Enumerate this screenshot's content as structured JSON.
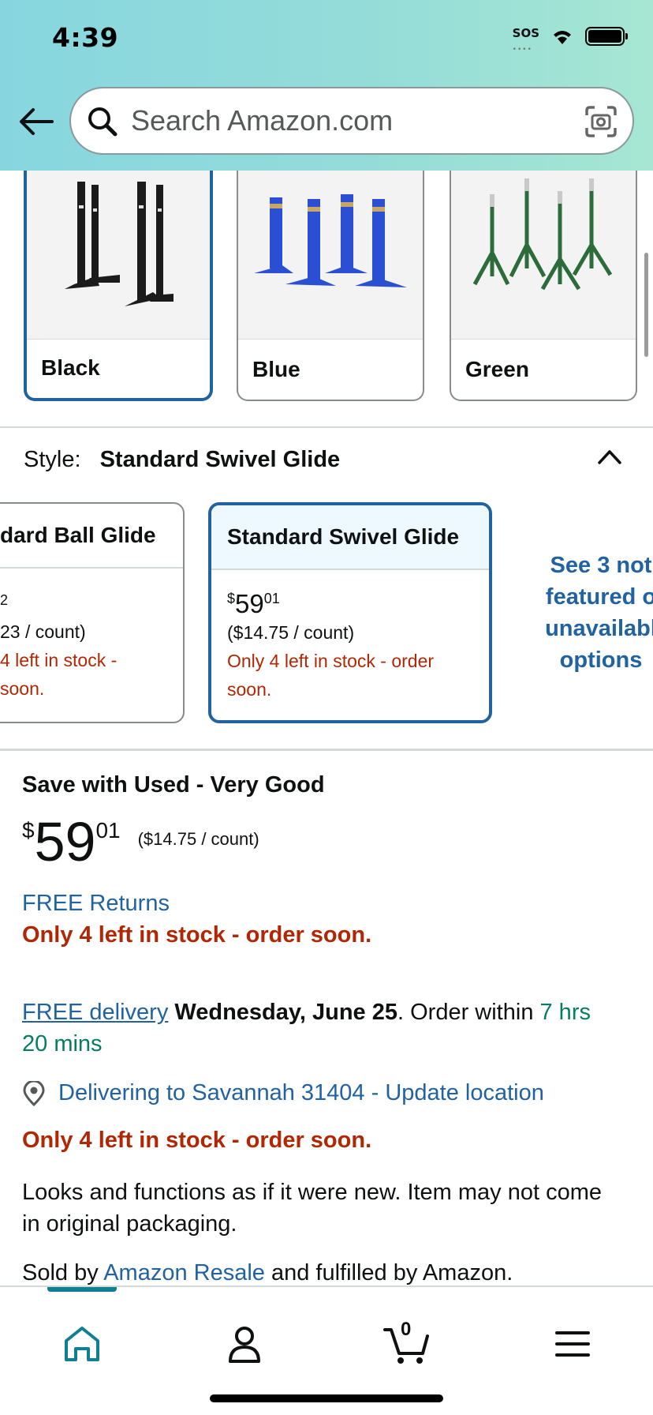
{
  "status_bar": {
    "time": "4:39",
    "sos": "SOS",
    "sos_dots": "••••"
  },
  "search": {
    "placeholder": "Search Amazon.com"
  },
  "colors": {
    "swatches": [
      {
        "label": "Black",
        "selected": true
      },
      {
        "label": "Blue",
        "selected": false
      },
      {
        "label": "Green",
        "selected": false
      }
    ]
  },
  "style": {
    "label": "Style:",
    "value": "Standard Swivel Glide",
    "cards": [
      {
        "title": "dard Ball Glide",
        "price_tail": "2",
        "unit": "23 / count)",
        "stock_line1": "4 left in stock -",
        "stock_line2": " soon."
      },
      {
        "title": "Standard Swivel Glide",
        "currency": "$",
        "price_whole": "59",
        "price_frac": "01",
        "unit": "($14.75 / count)",
        "stock_line1": "Only 4 left in stock - order",
        "stock_line2": "soon."
      }
    ],
    "see_more": [
      "See 3 not",
      "featured o",
      "unavailabl",
      "options"
    ]
  },
  "buy_box": {
    "title": "Save with Used - Very Good",
    "currency": "$",
    "price_whole": "59",
    "price_frac": "01",
    "unit": "($14.75 / count)",
    "returns": "FREE Returns",
    "stock": "Only 4 left in stock - order soon.",
    "delivery_link": "FREE delivery",
    "delivery_date": "Wednesday, June 25",
    "delivery_mid": ". Order within ",
    "delivery_time_1": "7 hrs",
    "delivery_time_2": "20 mins",
    "location": "Delivering to Savannah 31404 - Update location",
    "stock_2": "Only 4 left in stock - order soon.",
    "condition": "Looks and functions as if it were new. Item may not come in original packaging.",
    "sold_by_prefix": "Sold by ",
    "sold_by_link": "Amazon Resale",
    "sold_by_suffix": " and fulfilled by Amazon."
  },
  "nav": {
    "cart_count": "0",
    "accent": "#0f8092"
  },
  "theme": {
    "link": "#2162a1",
    "alert": "#b12704",
    "success": "#067d62",
    "selected_border": "#2162a1"
  }
}
